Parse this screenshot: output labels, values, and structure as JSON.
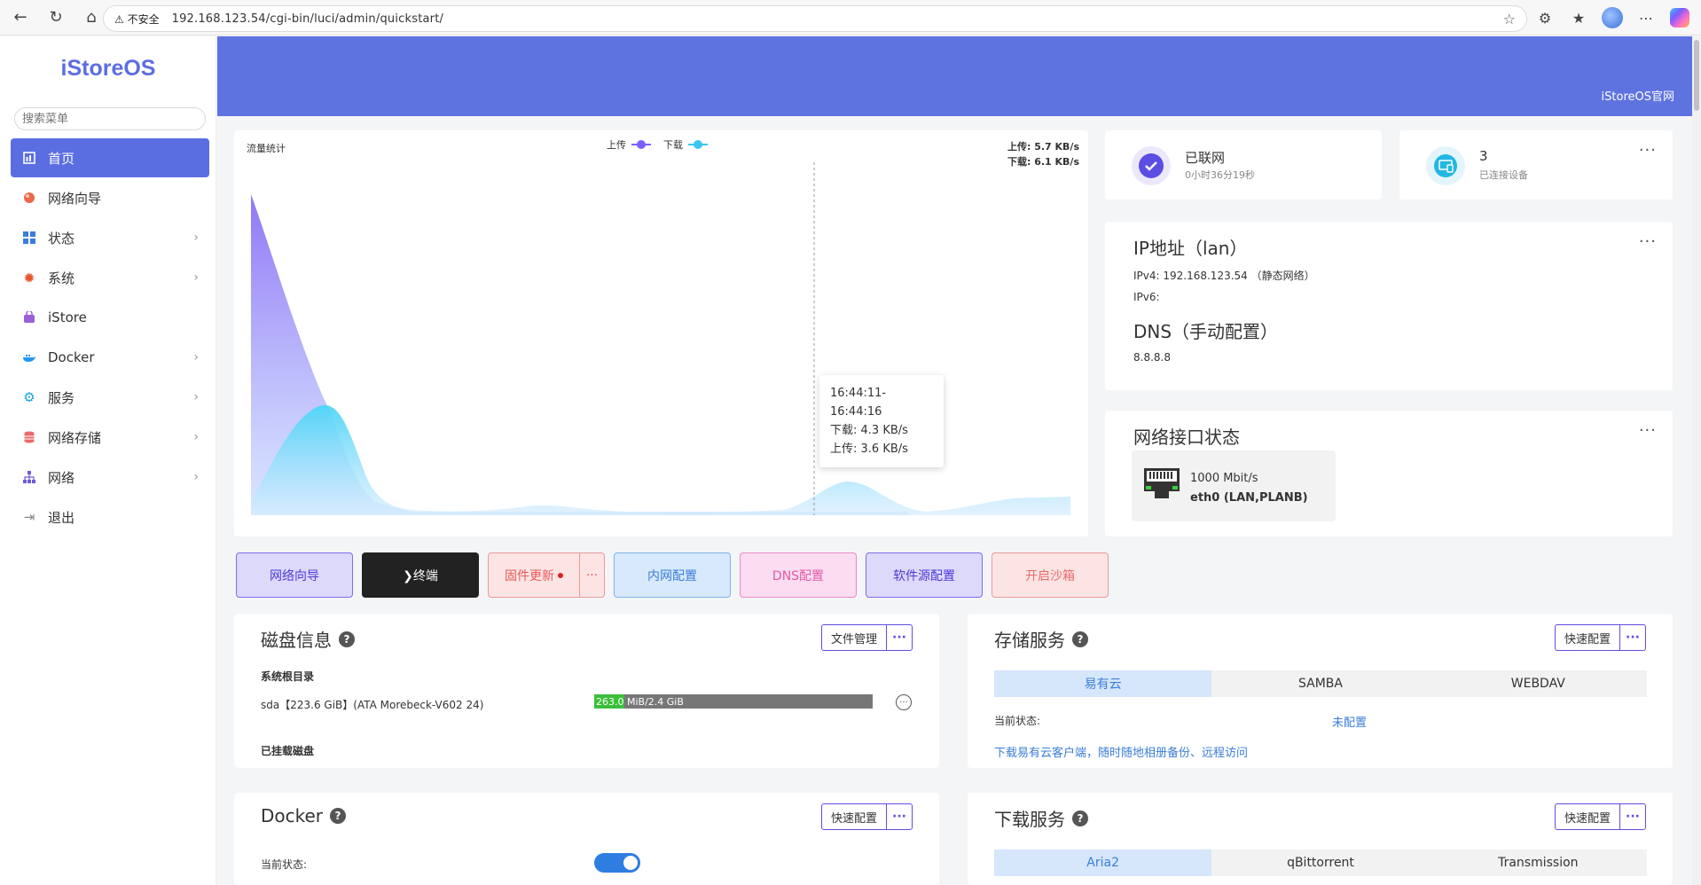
{
  "browser": {
    "insecure_label": "不安全",
    "url": "192.168.123.54/cgi-bin/luci/admin/quickstart/"
  },
  "sidebar": {
    "logo": "iStoreOS",
    "search_placeholder": "搜索菜单",
    "items": [
      {
        "label": "首页",
        "icon": "dashboard-icon"
      },
      {
        "label": "网络向导",
        "icon": "globe-icon"
      },
      {
        "label": "状态",
        "icon": "grid-icon"
      },
      {
        "label": "系统",
        "icon": "gear-icon"
      },
      {
        "label": "iStore",
        "icon": "store-icon"
      },
      {
        "label": "Docker",
        "icon": "docker-icon"
      },
      {
        "label": "服务",
        "icon": "services-icon"
      },
      {
        "label": "网络存储",
        "icon": "database-icon"
      },
      {
        "label": "网络",
        "icon": "network-icon"
      },
      {
        "label": "退出",
        "icon": "logout-icon"
      }
    ]
  },
  "banner": {
    "link": "iStoreOS官网"
  },
  "traffic": {
    "title": "流量统计",
    "legend_upload": "上传",
    "legend_download": "下载",
    "upload_rate": "上传: 5.7 KB/s",
    "download_rate": "下载: 6.1 KB/s",
    "tooltip_time": "16:44:11-16:44:16",
    "tooltip_download": "下载: 4.3 KB/s",
    "tooltip_upload": "上传: 3.6 KB/s",
    "colors": {
      "upload": "#7b61ff",
      "download": "#3cc6f0"
    }
  },
  "net_status": {
    "label": "已联网",
    "uptime": "0小时36分19秒"
  },
  "devices": {
    "count": "3",
    "label": "已连接设备"
  },
  "ip": {
    "title": "IP地址（lan）",
    "ipv4": "IPv4: 192.168.123.54 （静态网络）",
    "ipv6": "IPv6:",
    "dns_title": "DNS（手动配置）",
    "dns": "8.8.8.8"
  },
  "iface": {
    "title": "网络接口状态",
    "speed": "1000 Mbit/s",
    "name": "eth0 (LAN,PLANB)"
  },
  "quick": {
    "wizard": "网络向导",
    "terminal": "❯终端",
    "firmware": "固件更新",
    "lan": "内网配置",
    "dns": "DNS配置",
    "software": "软件源配置",
    "sandbox": "开启沙箱"
  },
  "disk": {
    "title": "磁盘信息",
    "btn": "文件管理",
    "root_label": "系统根目录",
    "device": "sda【223.6 GiB】(ATA Morebeck-V602 24)",
    "usage_used": "263.0",
    "usage_rest": " MiB/2.4 GiB",
    "usage_fraction": 0.107,
    "mounted_label": "已挂载磁盘"
  },
  "storage": {
    "title": "存储服务",
    "btn": "快速配置",
    "tabs": [
      "易有云",
      "SAMBA",
      "WEBDAV"
    ],
    "status_label": "当前状态:",
    "status_value": "未配置",
    "link": "下载易有云客户端，随时随地相册备份、远程访问"
  },
  "docker": {
    "title": "Docker",
    "btn": "快速配置",
    "status_label": "当前状态:"
  },
  "download": {
    "title": "下载服务",
    "btn": "快速配置",
    "tabs": [
      "Aria2",
      "qBittorrent",
      "Transmission"
    ]
  }
}
